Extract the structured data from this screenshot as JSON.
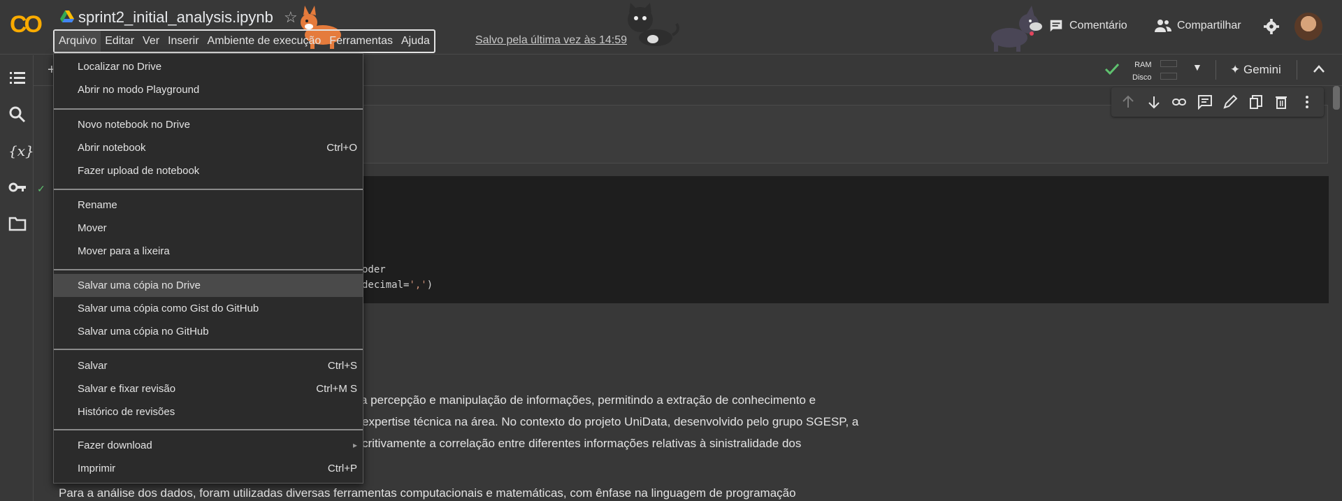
{
  "app": {
    "title": "sprint2_initial_analysis.ipynb",
    "logo_text": "CO",
    "saved_text": "Salvo pela última vez às 14:59"
  },
  "menubar": [
    "Arquivo",
    "Editar",
    "Ver",
    "Inserir",
    "Ambiente de execução",
    "Ferramentas",
    "Ajuda"
  ],
  "top_right": {
    "comment_label": "Comentário",
    "share_label": "Compartilhar"
  },
  "toolbar": {
    "ram_label": "RAM",
    "disk_label": "Disco",
    "gemini_label": "Gemini"
  },
  "file_menu": {
    "items": [
      {
        "label": "Localizar no Drive",
        "shortcut": ""
      },
      {
        "label": "Abrir no modo Playground",
        "shortcut": ""
      },
      {
        "label": "Novo notebook no Drive",
        "shortcut": ""
      },
      {
        "label": "Abrir notebook",
        "shortcut": "Ctrl+O"
      },
      {
        "label": "Fazer upload de notebook",
        "shortcut": ""
      },
      {
        "label": "Rename",
        "shortcut": ""
      },
      {
        "label": "Mover",
        "shortcut": ""
      },
      {
        "label": "Mover para a lixeira",
        "shortcut": ""
      },
      {
        "label": "Salvar uma cópia no Drive",
        "shortcut": ""
      },
      {
        "label": "Salvar uma cópia como Gist do GitHub",
        "shortcut": ""
      },
      {
        "label": "Salvar uma cópia no GitHub",
        "shortcut": ""
      },
      {
        "label": "Salvar",
        "shortcut": "Ctrl+S"
      },
      {
        "label": "Salvar e fixar revisão",
        "shortcut": "Ctrl+M S"
      },
      {
        "label": "Histórico de revisões",
        "shortcut": ""
      },
      {
        "label": "Fazer download",
        "shortcut": "▸"
      },
      {
        "label": "Imprimir",
        "shortcut": "Ctrl+P"
      }
    ]
  },
  "code": {
    "line1": "oder",
    "line2_a": " decimal=",
    "line2_str": "','",
    "line2_b": ")"
  },
  "text": {
    "line1": "a percepção e manipulação de informações, permitindo a extração de conhecimento e",
    "line2": "expertise técnica na área. No contexto do projeto UniData, desenvolvido pelo grupo SGESP, a",
    "line3": "critivamente a correlação entre diferentes informações relativas à sinistralidade dos",
    "line4": "Para a análise dos dados, foram utilizadas diversas ferramentas computacionais e matemáticas, com ênfase na linguagem de programação"
  },
  "colors": {
    "background": "#383838",
    "menu_bg": "#2b2b2b",
    "highlight": "#4a4a4a",
    "logo": "#f9ab00",
    "check": "#5fc26f"
  }
}
